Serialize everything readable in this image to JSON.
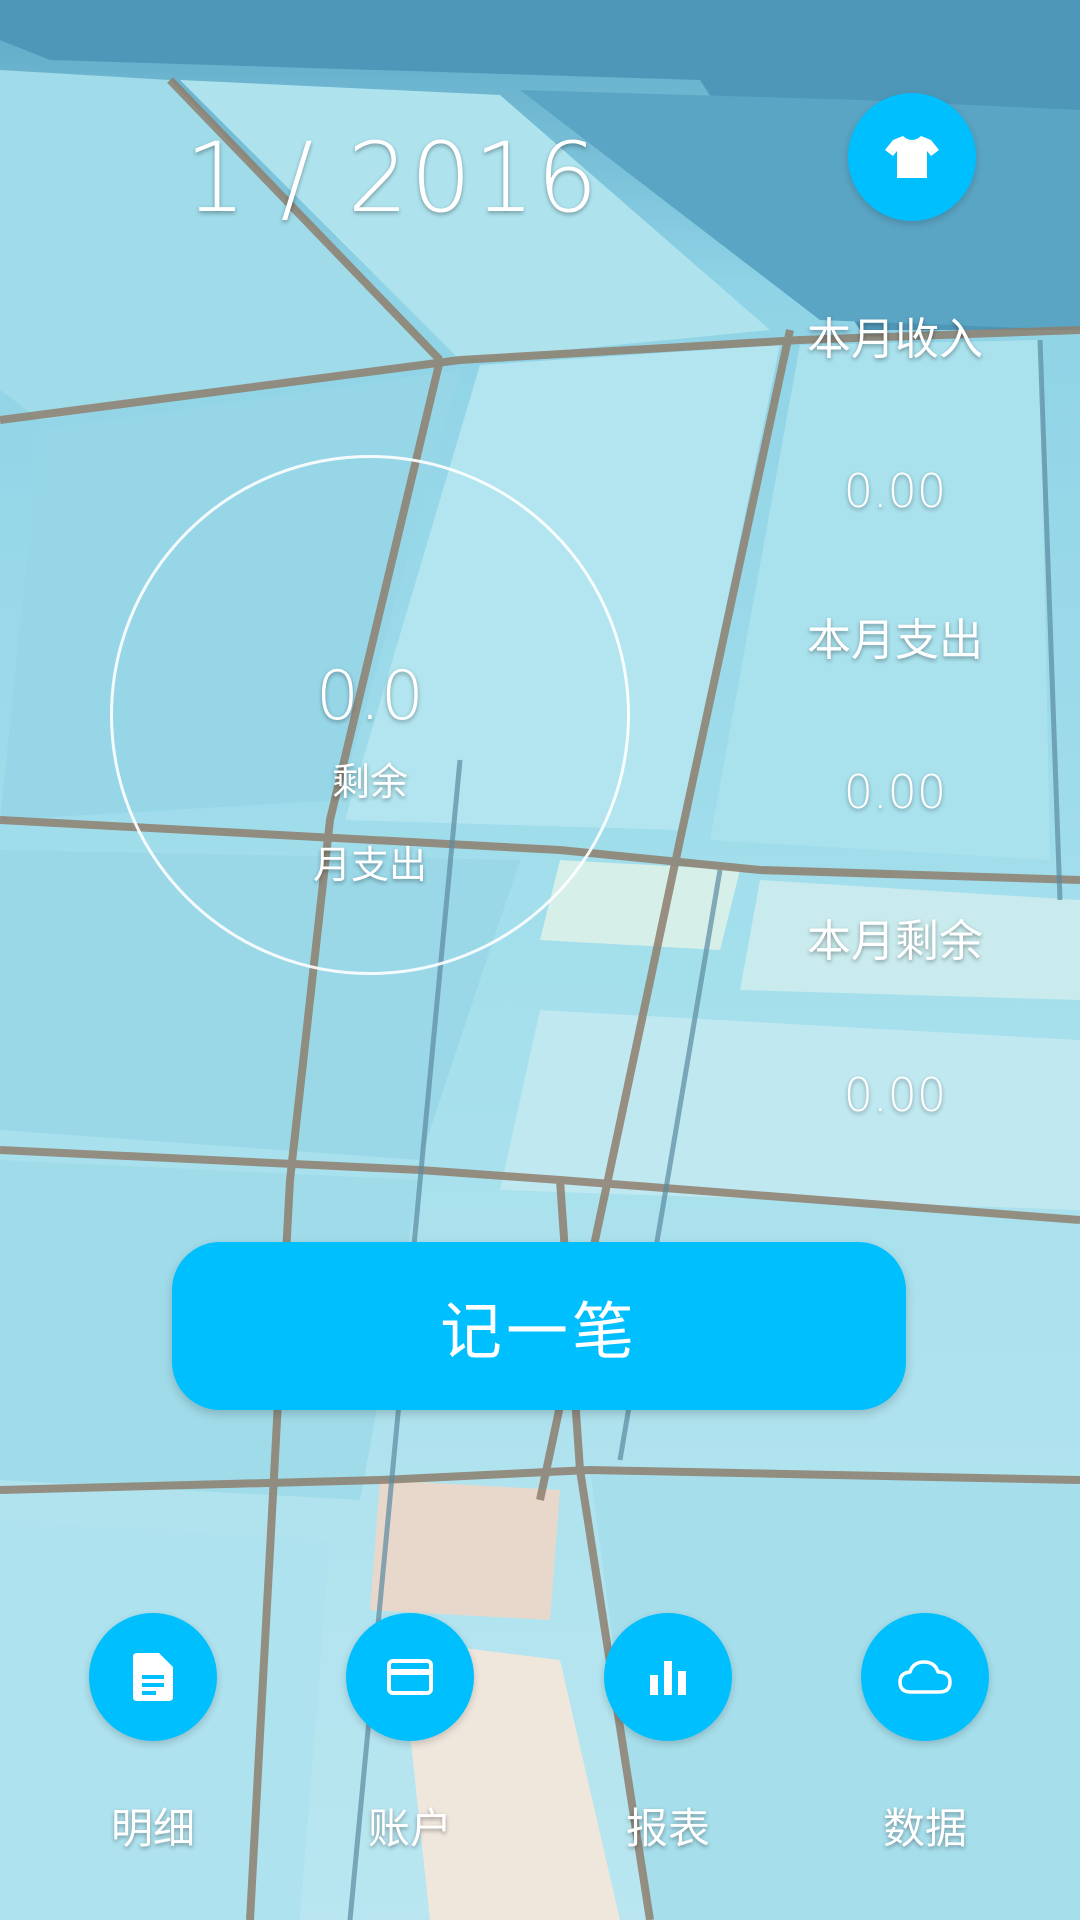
{
  "header": {
    "month_year": "1 / 2016",
    "theme_icon": "tshirt-icon"
  },
  "summary": {
    "income_label": "本月收入",
    "income_value": "0.00",
    "expense_label": "本月支出",
    "expense_value": "0.00",
    "remaining_label": "本月剩余",
    "remaining_value": "0.00"
  },
  "ring": {
    "value": "0.0",
    "label_line1": "剩余",
    "label_line2": "月支出"
  },
  "record_button": {
    "label": "记一笔"
  },
  "bottom_nav": {
    "items": [
      {
        "label": "明细",
        "icon": "document-icon"
      },
      {
        "label": "账户",
        "icon": "card-icon"
      },
      {
        "label": "报表",
        "icon": "bar-chart-icon"
      },
      {
        "label": "数据",
        "icon": "cloud-icon"
      }
    ]
  },
  "colors": {
    "accent": "#00bfff",
    "text": "#ffffff"
  }
}
